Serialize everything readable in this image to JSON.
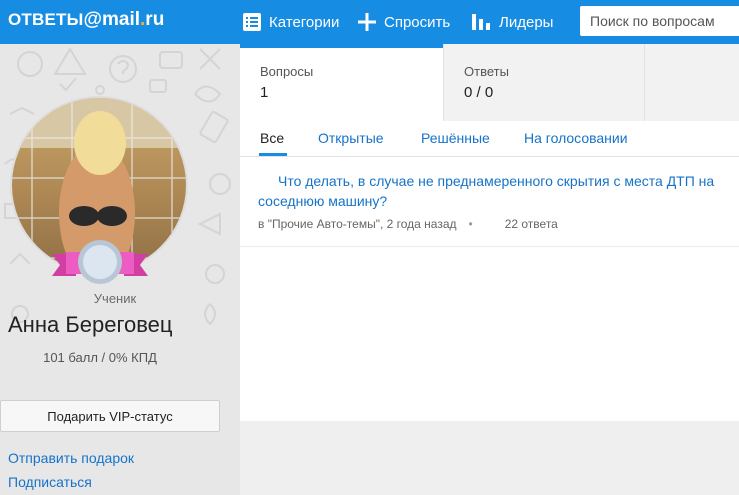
{
  "header": {
    "logo": {
      "part1": "ОТВЕТЫ",
      "at": "@",
      "part2": "mail",
      "dot": ".",
      "part3": "ru"
    },
    "nav": {
      "categories": "Категории",
      "ask": "Спросить",
      "leaders": "Лидеры"
    },
    "search_placeholder": "Поиск по вопросам",
    "colors": {
      "bar": "#168de2",
      "logo_accent": "#ffa930"
    }
  },
  "profile": {
    "rank": "Ученик",
    "name": "Анна Береговец",
    "points": "101 балл / 0% КПД",
    "vip_button": "Подарить VIP-статус",
    "links": {
      "gift": "Отправить подарок",
      "subscribe": "Подписаться"
    }
  },
  "stats": {
    "questions": {
      "label": "Вопросы",
      "value": "1"
    },
    "answers": {
      "label": "Ответы",
      "value": "0 / 0"
    }
  },
  "tabs": [
    "Все",
    "Открытые",
    "Решённые",
    "На голосовании"
  ],
  "questions": [
    {
      "title": "Что делать, в случае не преднамеренного скрытия с места ДТП на соседнюю машину?",
      "meta": "в \"Прочие Авто-темы\", 2 года назад",
      "answers": "22 ответа"
    }
  ]
}
